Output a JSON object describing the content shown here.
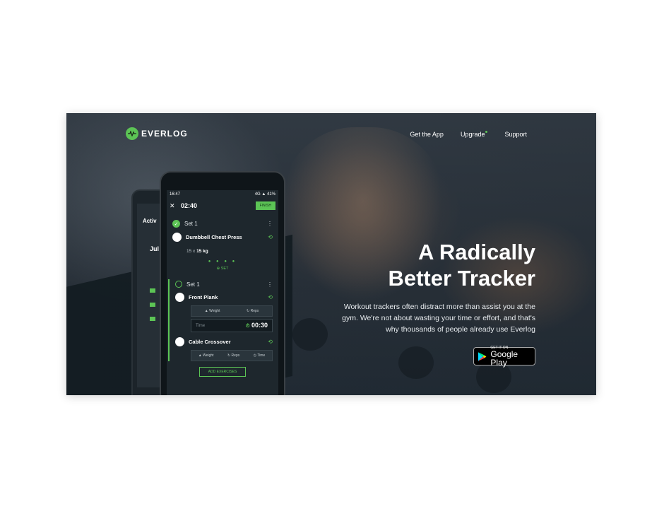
{
  "brand": {
    "name": "EVERLOG",
    "accent": "#5cc455"
  },
  "nav": {
    "get_app": "Get the App",
    "upgrade": "Upgrade",
    "support": "Support"
  },
  "hero": {
    "headline_line1": "A Radically",
    "headline_line2": "Better Tracker",
    "description": "Workout trackers often distract more than assist you at the gym. We're not about wasting your time or effort, and that's why thousands of people already use Everlog",
    "store_small": "GET IT ON",
    "store_big": "Google Play"
  },
  "phone": {
    "status_time": "16:47",
    "status_right": "4G ▲ 41%",
    "timer": "02:40",
    "finish": "FINISH",
    "set1_label": "Set 1",
    "exercise1": "Dumbbell Chest Press",
    "exercise1_reps": "15 x",
    "exercise1_weight": "15 kg",
    "add_set": "SET",
    "set2_label": "Set 1",
    "exercise2": "Front Plank",
    "weight_label": "Weight",
    "reps_label": "Reps",
    "time_placeholder": "Time",
    "time_value": "00:30",
    "exercise3": "Cable Crossover",
    "time_label": "Time",
    "add_exercises": "ADD EXERCISES"
  },
  "back_phone": {
    "title": "Activ",
    "month": "Jul"
  }
}
